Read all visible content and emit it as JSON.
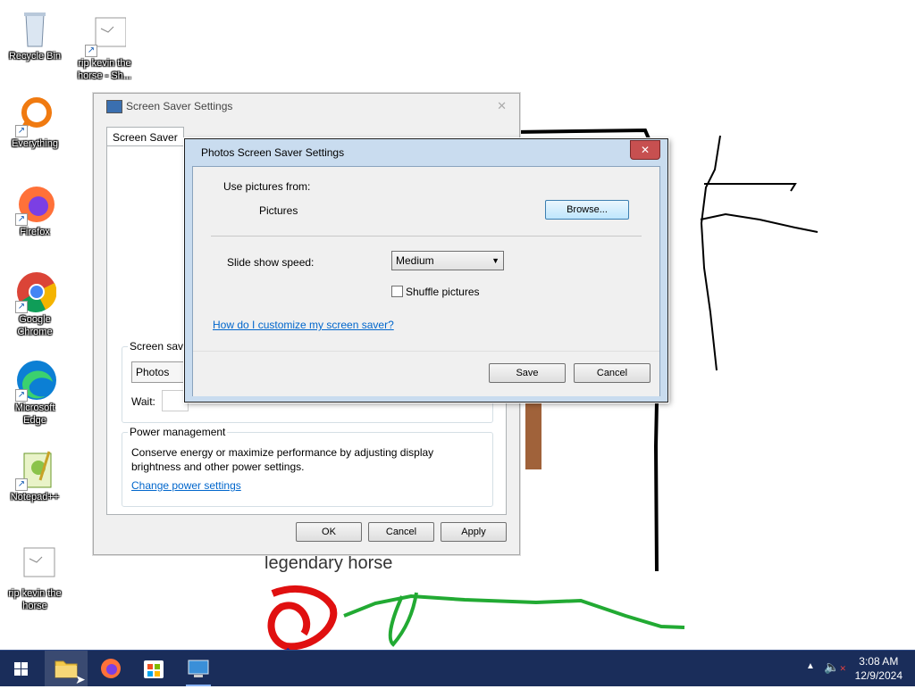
{
  "desktop": {
    "icons": [
      {
        "label": "Recycle Bin"
      },
      {
        "label": "rip kevin the horse - Sh..."
      },
      {
        "label": "Everything"
      },
      {
        "label": "Firefox"
      },
      {
        "label": "Google Chrome"
      },
      {
        "label": "Microsoft Edge"
      },
      {
        "label": "Notepad++"
      },
      {
        "label": "rip kevin the horse"
      }
    ],
    "drawing_caption": "legendary horse"
  },
  "screensaver_dialog": {
    "title": "Screen Saver Settings",
    "tab": "Screen Saver",
    "group_title": "Screen saver",
    "selected_saver": "Photos",
    "wait_label": "Wait:",
    "power_title": "Power management",
    "power_text": "Conserve energy or maximize performance by adjusting display brightness and other power settings.",
    "power_link": "Change power settings",
    "ok": "OK",
    "cancel": "Cancel",
    "apply": "Apply"
  },
  "photos_dialog": {
    "title": "Photos Screen Saver Settings",
    "close": "✕",
    "use_pictures_label": "Use pictures from:",
    "pictures_value": "Pictures",
    "browse": "Browse...",
    "speed_label": "Slide show speed:",
    "speed_value": "Medium",
    "shuffle_label": "Shuffle pictures",
    "shuffle_checked": false,
    "help_link": "How do I customize my screen saver?",
    "save": "Save",
    "cancel": "Cancel"
  },
  "taskbar": {
    "time": "3:08 AM",
    "date": "12/9/2024"
  },
  "colors": {
    "taskbar": "#1a2d5a",
    "close_red": "#c75050",
    "link": "#0066cc"
  }
}
